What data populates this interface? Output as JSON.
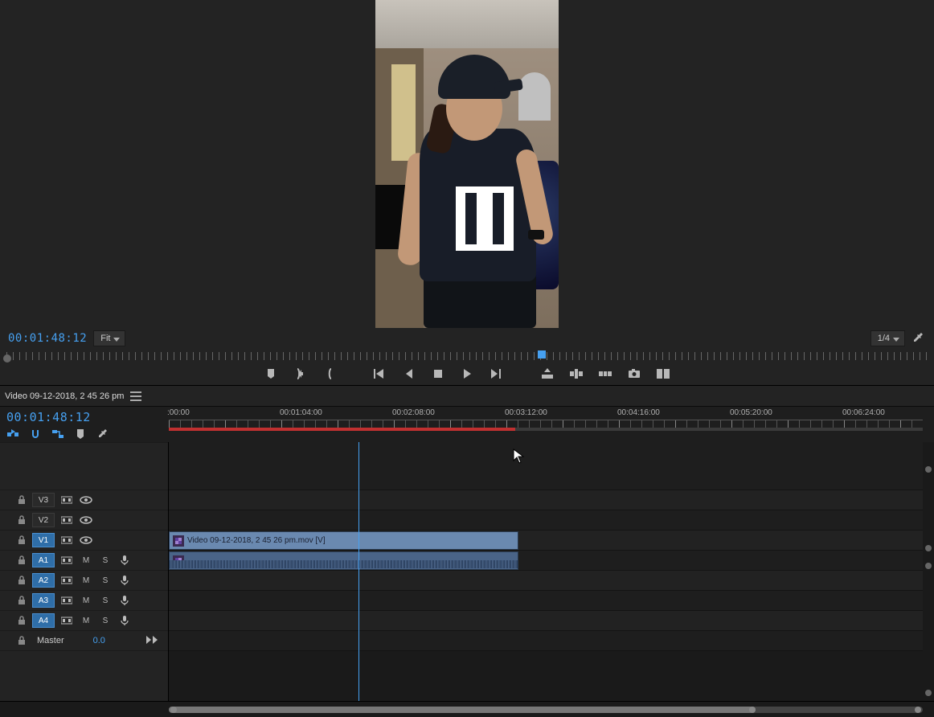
{
  "monitor": {
    "timecode": "00:01:48:12",
    "zoom_fit_label": "Fit",
    "resolution_label": "1/4"
  },
  "transport": {
    "marker": "add-marker",
    "in": "mark-in",
    "out": "mark-out",
    "goto_in": "go-to-in",
    "step_back": "step-back",
    "stop": "play-stop",
    "play": "play",
    "step_fwd": "step-forward",
    "goto_out": "go-to-out",
    "lift": "lift",
    "extract": "extract",
    "export": "export-frame",
    "snapshot": "snapshot",
    "compare": "comparison-view"
  },
  "timeline": {
    "sequence_name": "Video 09-12-2018, 2 45 26 pm",
    "playhead_timecode": "00:01:48:12",
    "ruler_labels": [
      ":00:00",
      "00:01:04:00",
      "00:02:08:00",
      "00:03:12:00",
      "00:04:16:00",
      "00:05:20:00",
      "00:06:24:00"
    ],
    "work_area_end_pct": 46,
    "playhead_pct": 25.2,
    "tools": [
      "nest-insert",
      "snap",
      "linked-selection",
      "marker",
      "settings"
    ],
    "tracks": {
      "video": [
        {
          "id": "V3",
          "targeted": false
        },
        {
          "id": "V2",
          "targeted": false
        },
        {
          "id": "V1",
          "targeted": true
        }
      ],
      "audio": [
        {
          "id": "A1",
          "targeted": true
        },
        {
          "id": "A2",
          "targeted": true
        },
        {
          "id": "A3",
          "targeted": true
        },
        {
          "id": "A4",
          "targeted": true
        }
      ],
      "master": {
        "label": "Master",
        "value": "0.0"
      }
    },
    "track_buttons": {
      "m": "M",
      "s": "S"
    },
    "clips": {
      "v1": {
        "name": "Video 09-12-2018, 2 45 26 pm.mov [V]",
        "start_pct": 0,
        "width_pct": 46.4
      },
      "a1": {
        "name": "",
        "start_pct": 0,
        "width_pct": 46.4
      }
    }
  }
}
